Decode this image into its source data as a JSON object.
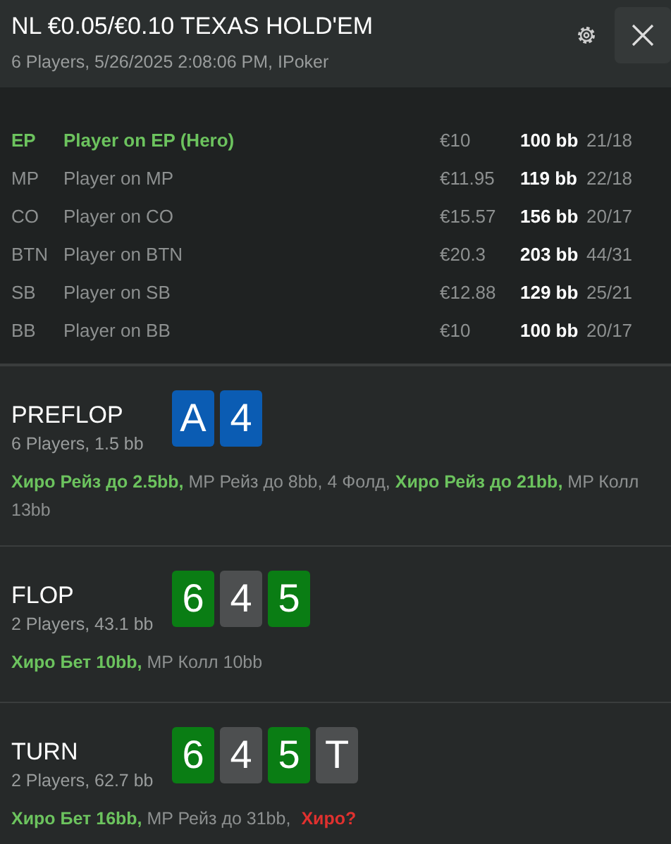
{
  "header": {
    "title": "NL €0.05/€0.10 TEXAS HOLD'EM",
    "subtitle": "6 Players, 5/26/2025 2:08:06 PM, IPoker"
  },
  "players": [
    {
      "position": "EP",
      "name": "Player on EP (Hero)",
      "stack": "€10",
      "bb": "100 bb",
      "stats": "21/18",
      "hero": true
    },
    {
      "position": "MP",
      "name": "Player on MP",
      "stack": "€11.95",
      "bb": "119 bb",
      "stats": "22/18",
      "hero": false
    },
    {
      "position": "CO",
      "name": "Player on CO",
      "stack": "€15.57",
      "bb": "156 bb",
      "stats": "20/17",
      "hero": false
    },
    {
      "position": "BTN",
      "name": "Player on BTN",
      "stack": "€20.3",
      "bb": "203 bb",
      "stats": "44/31",
      "hero": false
    },
    {
      "position": "SB",
      "name": "Player on SB",
      "stack": "€12.88",
      "bb": "129 bb",
      "stats": "25/21",
      "hero": false
    },
    {
      "position": "BB",
      "name": "Player on BB",
      "stack": "€10",
      "bb": "100 bb",
      "stats": "20/17",
      "hero": false
    }
  ],
  "streets": [
    {
      "name": "PREFLOP",
      "info": "6 Players, 1.5 bb",
      "cards": [
        {
          "rank": "A",
          "color": "#0b5cb3"
        },
        {
          "rank": "4",
          "color": "#0b5cb3"
        }
      ],
      "actions": [
        {
          "kind": "hero",
          "text": "Хиро Рейз до 2.5bb,"
        },
        {
          "kind": "other",
          "text": "MP Рейз до 8bb, 4 Фолд,"
        },
        {
          "kind": "hero",
          "text": "Хиро Рейз до 21bb,"
        },
        {
          "kind": "other",
          "text": "MP Колл 13bb"
        }
      ]
    },
    {
      "name": "FLOP",
      "info": "2 Players, 43.1 bb",
      "cards": [
        {
          "rank": "6",
          "color": "#0a7d14"
        },
        {
          "rank": "4",
          "color": "#4d4f50"
        },
        {
          "rank": "5",
          "color": "#0a7d14"
        }
      ],
      "actions": [
        {
          "kind": "hero",
          "text": "Хиро Бет 10bb,"
        },
        {
          "kind": "other",
          "text": "MP Колл 10bb"
        }
      ]
    },
    {
      "name": "TURN",
      "info": "2 Players, 62.7 bb",
      "cards": [
        {
          "rank": "6",
          "color": "#0a7d14"
        },
        {
          "rank": "4",
          "color": "#4d4f50"
        },
        {
          "rank": "5",
          "color": "#0a7d14"
        },
        {
          "rank": "T",
          "color": "#4d4f50"
        }
      ],
      "actions": [
        {
          "kind": "hero",
          "text": "Хиро Бет 16bb,"
        },
        {
          "kind": "other",
          "text": "MP Рейз до 31bb,"
        },
        {
          "kind": "question",
          "text": "Хиро?"
        }
      ]
    }
  ]
}
